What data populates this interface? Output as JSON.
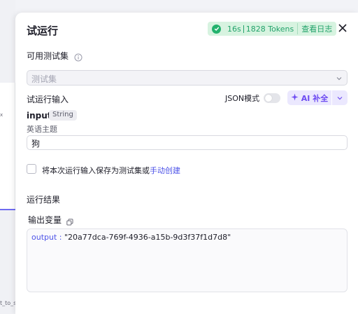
{
  "background": {
    "node_label_fragment": "t_to_st",
    "small_glyph": "x"
  },
  "panel": {
    "title": "试运行",
    "status": {
      "duration": "16s",
      "tokens": "1828 Tokens",
      "log_link": "查看日志",
      "color": "#23a36b"
    },
    "close_icon": "close-icon"
  },
  "testset": {
    "label": "可用测试集",
    "placeholder": "测试集"
  },
  "run_input": {
    "label": "试运行输入",
    "json_mode_label": "JSON模式",
    "json_mode_enabled": false,
    "ai_button_label": "AI 补全",
    "variable": {
      "name": "input",
      "type": "String",
      "description": "英语主题",
      "value": "狗"
    },
    "save_checkbox": {
      "checked": false,
      "text": "将本次运行输入保存为测试集或",
      "link": "手动创建"
    }
  },
  "result": {
    "label": "运行结果",
    "output_var_label": "输出变量",
    "output_key": "output",
    "output_value": "\"20a77dca-769f-4936-a15b-9d3f37f1d7d8\""
  },
  "colors": {
    "accent": "#4d53e8",
    "ai_purple": "#6d4bf2",
    "success": "#23b26d"
  }
}
